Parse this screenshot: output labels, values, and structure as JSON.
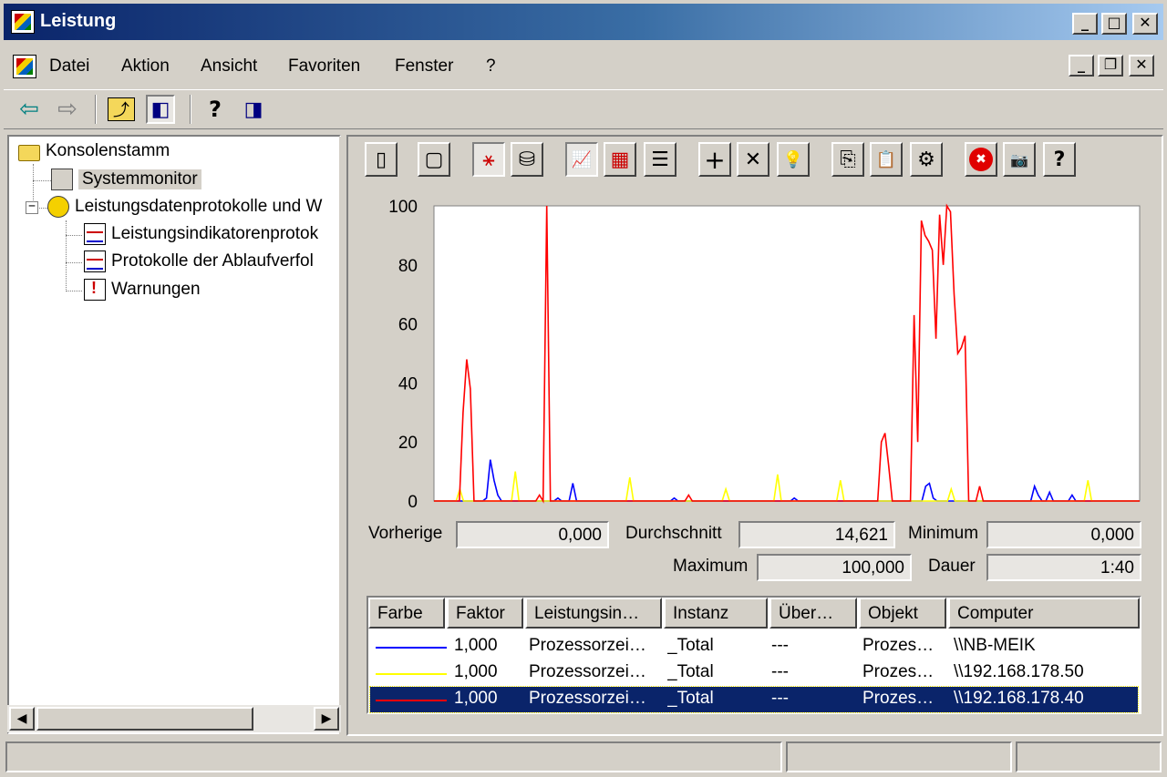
{
  "window": {
    "title": "Leistung",
    "icon": "perfmon-app-icon",
    "controls": {
      "minimize": "_",
      "maximize": "□",
      "close": "✕",
      "restore": "❐"
    }
  },
  "menubar": {
    "items": [
      "Datei",
      "Aktion",
      "Ansicht",
      "Favoriten",
      "Fenster",
      "?"
    ]
  },
  "toolbar": {
    "icons": [
      "back-arrow-icon",
      "forward-arrow-icon",
      "up-folder-icon",
      "show-hide-tree-icon",
      "help-icon",
      "properties-pane-icon"
    ],
    "glyphs": {
      "back": "⇦",
      "forward": "⇨",
      "up": "⤴",
      "tree": "◧",
      "help": "?",
      "pane": "◨"
    }
  },
  "tree": {
    "root": "Konsolenstamm",
    "expander": "−",
    "items": [
      {
        "label": "Systemmonitor",
        "icon": "system-monitor-icon",
        "selected": true
      },
      {
        "label": "Leistungsdatenprotokolle und W",
        "icon": "performance-logs-icon"
      },
      {
        "label": "Leistungsindikatorenprotok",
        "icon": "counter-log-icon"
      },
      {
        "label": "Protokolle der Ablaufverfol",
        "icon": "trace-log-icon"
      },
      {
        "label": "Warnungen",
        "icon": "alert-icon"
      }
    ]
  },
  "graph_toolbar": {
    "glyphs": {
      "new": "▯",
      "clear": "▢",
      "view-current": "⚹",
      "view-log": "⛁",
      "graph": "📈",
      "histogram": "▦",
      "report": "☰",
      "add": "+",
      "delete": "✕",
      "highlight": "💡",
      "copy": "⎘",
      "paste": "📋",
      "properties": "⚙",
      "freeze": "✖",
      "update": "📷",
      "help": "?"
    }
  },
  "chart_data": {
    "type": "line",
    "ylim": [
      0,
      100
    ],
    "y_ticks": [
      "100",
      "80",
      "60",
      "40",
      "20",
      "0"
    ],
    "grid": false,
    "series": [
      {
        "color": "#0000ff",
        "values": [
          0,
          0,
          0,
          0,
          0,
          0,
          0,
          0,
          0,
          0,
          0,
          0,
          0,
          0,
          1,
          14,
          7,
          2,
          0,
          0,
          0,
          0,
          0,
          0,
          0,
          0,
          0,
          0,
          0,
          0,
          0,
          0,
          0,
          1,
          0,
          0,
          0,
          6,
          0,
          0,
          0,
          0,
          0,
          0,
          0,
          0,
          0,
          0,
          0,
          0,
          0,
          0,
          0,
          0,
          0,
          0,
          0,
          0,
          0,
          0,
          0,
          0,
          0,
          0,
          1,
          0,
          0,
          0,
          0,
          0,
          0,
          0,
          0,
          0,
          0,
          0,
          0,
          0,
          0,
          0,
          0,
          0,
          0,
          0,
          0,
          0,
          0,
          0,
          0,
          0,
          0,
          0,
          0,
          0,
          0,
          0,
          1,
          0,
          0,
          0,
          0,
          0,
          0,
          0,
          0,
          0,
          0,
          0,
          0,
          0,
          0,
          0,
          0,
          0,
          0,
          0,
          0,
          0,
          0,
          0,
          0,
          0,
          0,
          0,
          0,
          0,
          0,
          0,
          0,
          0,
          0,
          5,
          6,
          1,
          0,
          0,
          0,
          0,
          0,
          0,
          0,
          0,
          0,
          0,
          0,
          0,
          0,
          0,
          0,
          0,
          0,
          0,
          0,
          0,
          0,
          0,
          0,
          0,
          0,
          0,
          5,
          2,
          0,
          0,
          3,
          0,
          0,
          0,
          0,
          0,
          2,
          0,
          0,
          0,
          0,
          0,
          0,
          0,
          0,
          0,
          0,
          0,
          0,
          0,
          0,
          0,
          0,
          0,
          0
        ]
      },
      {
        "color": "#ffff00",
        "values": [
          0,
          0,
          0,
          0,
          0,
          0,
          0,
          4,
          0,
          0,
          0,
          0,
          0,
          0,
          0,
          0,
          0,
          0,
          0,
          0,
          0,
          0,
          10,
          0,
          0,
          0,
          0,
          0,
          0,
          0,
          0,
          0,
          0,
          0,
          0,
          0,
          0,
          0,
          0,
          0,
          0,
          0,
          0,
          0,
          0,
          0,
          0,
          0,
          0,
          0,
          0,
          0,
          0,
          8,
          0,
          0,
          0,
          0,
          0,
          0,
          0,
          0,
          0,
          0,
          0,
          0,
          0,
          0,
          0,
          0,
          0,
          0,
          0,
          0,
          0,
          0,
          0,
          0,
          0,
          4,
          0,
          0,
          0,
          0,
          0,
          0,
          0,
          0,
          0,
          0,
          0,
          0,
          0,
          9,
          0,
          0,
          0,
          0,
          0,
          0,
          0,
          0,
          0,
          0,
          0,
          0,
          0,
          0,
          0,
          0,
          7,
          0,
          0,
          0,
          0,
          0,
          0,
          0,
          0,
          0,
          0,
          0,
          0,
          0,
          0,
          0,
          0,
          0,
          0,
          0,
          0,
          0,
          0,
          0,
          0,
          0,
          0,
          0,
          0,
          0,
          4,
          0,
          0,
          0,
          0,
          0,
          0,
          0,
          0,
          0,
          0,
          0,
          0,
          0,
          0,
          0,
          0,
          0,
          0,
          0,
          0,
          0,
          0,
          0,
          0,
          0,
          0,
          0,
          0,
          0,
          0,
          0,
          0,
          0,
          0,
          0,
          0,
          7,
          0,
          0,
          0,
          0,
          0,
          0,
          0,
          0,
          0,
          0,
          0,
          0,
          0,
          0
        ]
      },
      {
        "color": "#ff0000",
        "values": [
          0,
          0,
          0,
          0,
          0,
          0,
          0,
          0,
          30,
          48,
          38,
          0,
          0,
          0,
          0,
          0,
          0,
          0,
          0,
          0,
          0,
          0,
          0,
          0,
          0,
          0,
          0,
          0,
          0,
          2,
          0,
          100,
          0,
          0,
          0,
          0,
          0,
          0,
          0,
          0,
          0,
          0,
          0,
          0,
          0,
          0,
          0,
          0,
          0,
          0,
          0,
          0,
          0,
          0,
          0,
          0,
          0,
          0,
          0,
          0,
          0,
          0,
          0,
          0,
          0,
          0,
          0,
          0,
          0,
          0,
          2,
          0,
          0,
          0,
          0,
          0,
          0,
          0,
          0,
          0,
          0,
          0,
          0,
          0,
          0,
          0,
          0,
          0,
          0,
          0,
          0,
          0,
          0,
          0,
          0,
          0,
          0,
          0,
          0,
          0,
          0,
          0,
          0,
          0,
          0,
          0,
          0,
          0,
          0,
          0,
          0,
          0,
          0,
          0,
          0,
          0,
          0,
          0,
          0,
          0,
          0,
          0,
          0,
          20,
          23,
          12,
          0,
          0,
          0,
          0,
          0,
          0,
          63,
          20,
          95,
          90,
          88,
          85,
          55,
          97,
          80,
          100,
          98,
          70,
          50,
          52,
          56,
          0,
          0,
          0,
          5,
          0,
          0,
          0,
          0,
          0,
          0,
          0,
          0,
          0,
          0,
          0,
          0,
          0,
          0,
          0,
          0,
          0,
          0,
          0,
          0,
          0,
          0,
          0,
          0,
          0,
          0,
          0,
          0,
          0,
          0,
          0,
          0,
          0,
          0,
          0,
          0,
          0,
          0,
          0,
          0,
          0,
          0,
          0,
          0
        ]
      }
    ]
  },
  "stats": {
    "prev_label": "Vorherige",
    "prev_value": "0,000",
    "avg_label": "Durchschnitt",
    "avg_value": "14,621",
    "min_label": "Minimum",
    "min_value": "0,000",
    "max_label": "Maximum",
    "max_value": "100,000",
    "dur_label": "Dauer",
    "dur_value": "1:40"
  },
  "legend": {
    "columns": [
      "Farbe",
      "Faktor",
      "Leistungsin…",
      "Instanz",
      "Über…",
      "Objekt",
      "Computer"
    ],
    "rows": [
      {
        "color": "#0000ff",
        "factor": "1,000",
        "counter": "Prozessorzei…",
        "instance": "_Total",
        "parent": "---",
        "object": "Prozes…",
        "computer": "\\\\NB-MEIK",
        "selected": false
      },
      {
        "color": "#ffff00",
        "factor": "1,000",
        "counter": "Prozessorzei…",
        "instance": "_Total",
        "parent": "---",
        "object": "Prozes…",
        "computer": "\\\\192.168.178.50",
        "selected": false
      },
      {
        "color": "#ff0000",
        "factor": "1,000",
        "counter": "Prozessorzei…",
        "instance": "_Total",
        "parent": "---",
        "object": "Prozes…",
        "computer": "\\\\192.168.178.40",
        "selected": true
      }
    ]
  },
  "scrollbar": {
    "left": "◀",
    "right": "▶"
  },
  "statusbar": {
    "cells": [
      "",
      "",
      ""
    ]
  }
}
